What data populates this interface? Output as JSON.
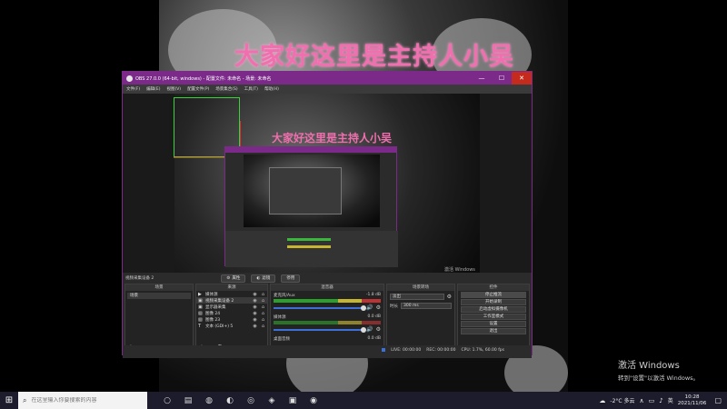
{
  "wallpaper": {
    "banner": "大家好这里是主持人小吴"
  },
  "obs_window": {
    "title": "OBS 27.0.0 (64-bit, windows) - 配置文件: 未命名 - 场景: 未命名",
    "controls": {
      "minimize": "—",
      "maximize": "☐",
      "close": "✕"
    },
    "menu": [
      "文件(F)",
      "编辑(E)",
      "视图(V)",
      "配置文件(P)",
      "场景集合(S)",
      "工具(T)",
      "帮助(H)"
    ],
    "preview": {
      "banner": "大家好这里是主持人小吴",
      "watermark": "激活 Windows"
    },
    "source_toolbar": {
      "label": "视频采集设备 2",
      "properties": "属性",
      "filters": "滤镜",
      "deactivate": "停用"
    },
    "docks": {
      "scenes": {
        "header": "场景",
        "items": [
          "场景"
        ]
      },
      "sources": {
        "header": "来源",
        "items": [
          {
            "icon": "▶",
            "name": "媒体源"
          },
          {
            "icon": "▣",
            "name": "视频采集设备 2"
          },
          {
            "icon": "▣",
            "name": "显示器采集"
          },
          {
            "icon": "▧",
            "name": "图像 24"
          },
          {
            "icon": "▧",
            "name": "图像 23"
          },
          {
            "icon": "T",
            "name": "文本 (GDI+) 5"
          }
        ]
      },
      "mixer": {
        "header": "混音器",
        "channels": [
          {
            "name": "麦克风/Aux",
            "db": "-1.8 dB"
          },
          {
            "name": "媒体源",
            "db": "0.0 dB"
          },
          {
            "name": "桌面音频",
            "db": "0.0 dB"
          }
        ]
      },
      "transitions": {
        "header": "场景转场",
        "type": "淡出",
        "duration_label": "时长",
        "duration_value": "300 ms"
      },
      "controls": {
        "header": "控件",
        "buttons": [
          "停止推流",
          "开始录制",
          "启动虚拟摄像机",
          "工作室模式",
          "设置",
          "退出"
        ]
      }
    },
    "status": {
      "live": "LIVE: 00:00:00",
      "rec": "REC: 00:00:00",
      "cpu": "CPU: 1.7%, 60.00 fps"
    }
  },
  "activation": {
    "line1": "激活 Windows",
    "line2": "转到\"设置\"以激活 Windows。"
  },
  "taskbar": {
    "search_placeholder": "在这里输入你要搜索的内容",
    "weather": "-2°C 多云",
    "ime": "英",
    "time": "10:28",
    "date": "2021/11/06"
  }
}
